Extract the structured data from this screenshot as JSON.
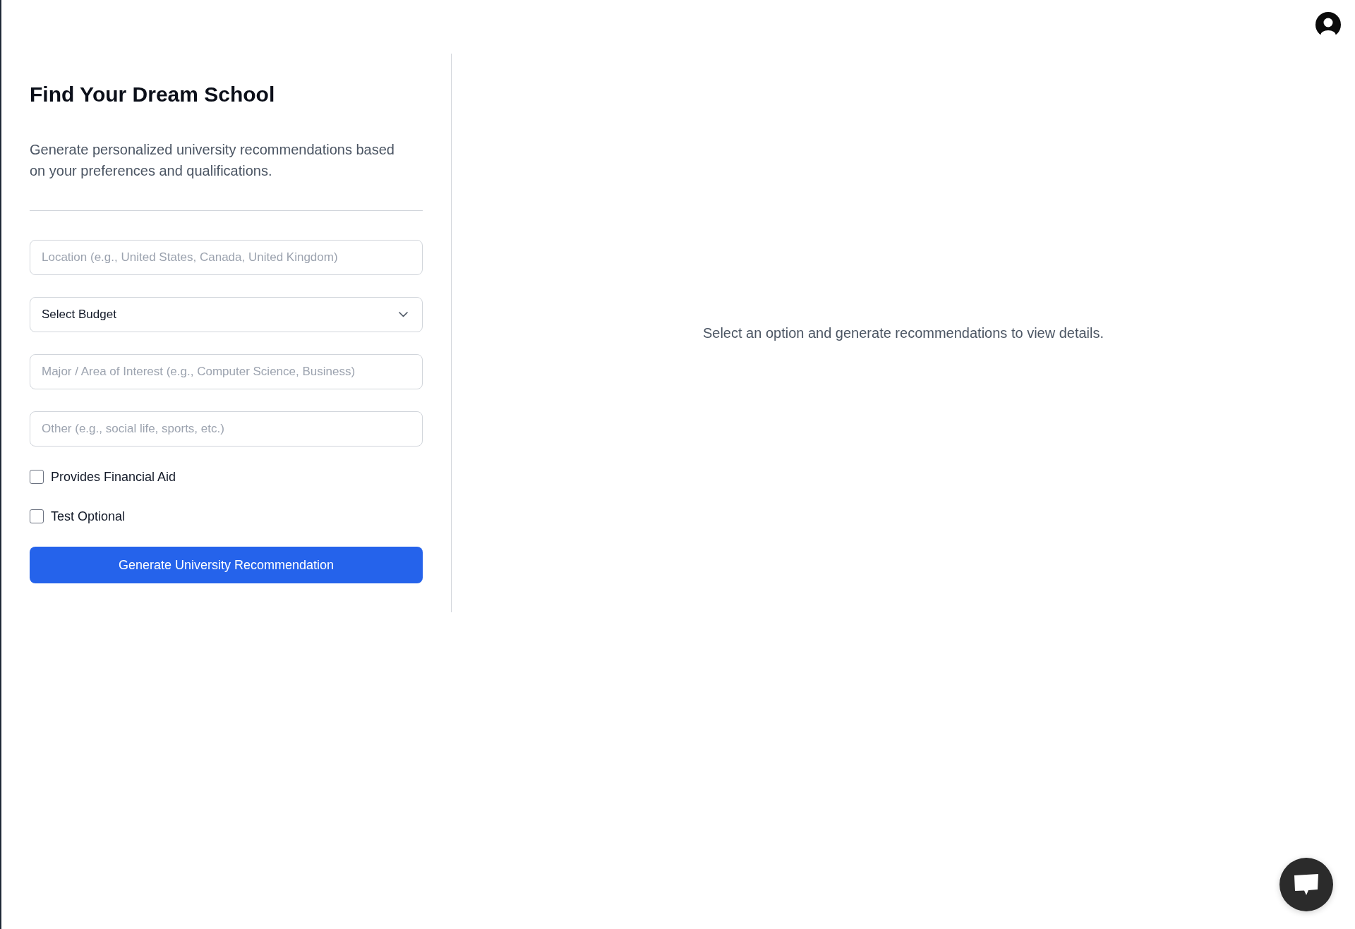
{
  "form": {
    "title": "Find Your Dream School",
    "description": "Generate personalized university recommendations based on your preferences and qualifications.",
    "fields": [
      {
        "kind": "text",
        "placeholder": "Location (e.g., United States, Canada, United Kingdom)"
      },
      {
        "kind": "select",
        "value": "Select Budget"
      },
      {
        "kind": "text",
        "placeholder": "Major / Area of Interest (e.g., Computer Science, Business)"
      },
      {
        "kind": "text",
        "placeholder": "Other (e.g., social life, sports, etc.)"
      }
    ],
    "checkboxes": [
      {
        "label": "Provides Financial Aid",
        "checked": false
      },
      {
        "label": "Test Optional",
        "checked": false
      }
    ],
    "generate_button": "Generate University Recommendation"
  },
  "details_panel": {
    "empty_message": "Select an option and generate recommendations to view details."
  }
}
